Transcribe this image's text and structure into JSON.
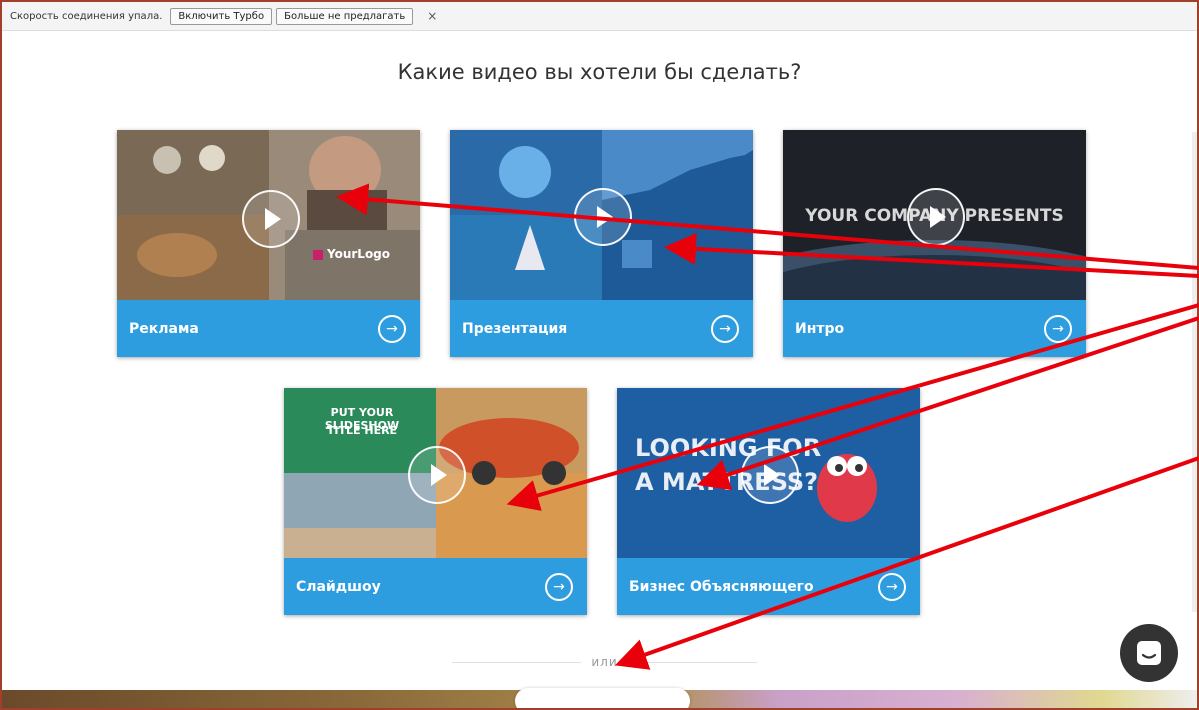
{
  "notification": {
    "text": "Скорость соединения упала.",
    "turbo_button": "Включить Турбо",
    "dismiss_button": "Больше не предлагать",
    "close": "×"
  },
  "heading": "Какие видео вы хотели бы сделать?",
  "cards": [
    {
      "label": "Реклама",
      "thumb_text": "YourLogo"
    },
    {
      "label": "Презентация"
    },
    {
      "label": "Интро",
      "thumb_text": "YOUR COMPANY PRESENTS"
    },
    {
      "label": "Слайдшоу",
      "thumb_text_1": "PUT YOUR SLIDESHOW",
      "thumb_text_2": "TITLE HERE"
    },
    {
      "label": "Бизнес Объясняющего",
      "thumb_text_1": "LOOKING FOR",
      "thumb_text_2": "A MATTRESS?"
    }
  ],
  "divider_text": "или",
  "colors": {
    "accent": "#2e9de0",
    "annotation_arrow": "#e8000b"
  }
}
